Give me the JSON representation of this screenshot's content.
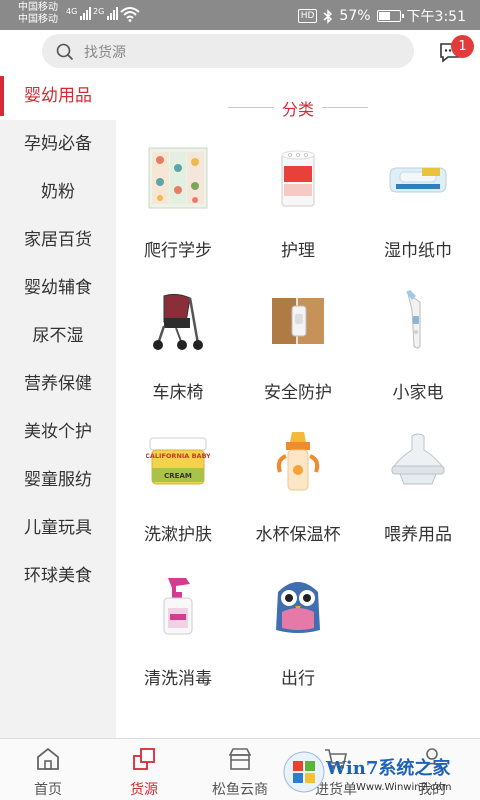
{
  "status_bar": {
    "carrier1": "中国移动",
    "carrier2": "中国移动",
    "net1": "4G",
    "net2": "2G",
    "battery_percent": "57%",
    "battery_level": 0.57,
    "time": "下午3:51",
    "hd": "HD"
  },
  "header": {
    "search_placeholder": "找货源",
    "message_badge": "1"
  },
  "sidebar": {
    "items": [
      {
        "label": "婴幼用品",
        "active": true
      },
      {
        "label": "孕妈必备"
      },
      {
        "label": "奶粉"
      },
      {
        "label": "家居百货"
      },
      {
        "label": "婴幼辅食"
      },
      {
        "label": "尿不湿"
      },
      {
        "label": "营养保健"
      },
      {
        "label": "美妆个护"
      },
      {
        "label": "婴童服纺"
      },
      {
        "label": "儿童玩具"
      },
      {
        "label": "环球美食"
      }
    ]
  },
  "content": {
    "section_title": "分类",
    "categories": [
      {
        "label": "爬行学步",
        "icon": "play-mat-icon"
      },
      {
        "label": "护理",
        "icon": "cotton-swab-box-icon"
      },
      {
        "label": "湿巾纸巾",
        "icon": "wet-wipes-icon"
      },
      {
        "label": "车床椅",
        "icon": "stroller-icon"
      },
      {
        "label": "安全防护",
        "icon": "safety-lock-icon"
      },
      {
        "label": "小家电",
        "icon": "ear-thermometer-icon"
      },
      {
        "label": "洗漱护肤",
        "icon": "cream-jar-icon"
      },
      {
        "label": "水杯保温杯",
        "icon": "sippy-cup-icon"
      },
      {
        "label": "喂养用品",
        "icon": "bottle-nipple-icon"
      },
      {
        "label": "清洗消毒",
        "icon": "spray-bottle-icon"
      },
      {
        "label": "出行",
        "icon": "owl-backpack-icon"
      }
    ],
    "product_texts": {
      "cream_brand": "CALIFORNIA BABY",
      "cream_word": "CREAM"
    }
  },
  "bottom_nav": {
    "items": [
      {
        "label": "首页",
        "icon": "home-icon"
      },
      {
        "label": "货源",
        "icon": "supply-icon",
        "active": true
      },
      {
        "label": "松鱼云商",
        "icon": "store-icon"
      },
      {
        "label": "进货单",
        "icon": "cart-icon"
      },
      {
        "label": "我的",
        "icon": "user-icon"
      }
    ]
  },
  "watermark": {
    "text": "Win7系统之家",
    "url": "Www.Winwin7.com"
  },
  "colors": {
    "accent": "#d62a35",
    "status_bar": "#8a8a8a",
    "sidebar_bg": "#f2f2f2"
  }
}
